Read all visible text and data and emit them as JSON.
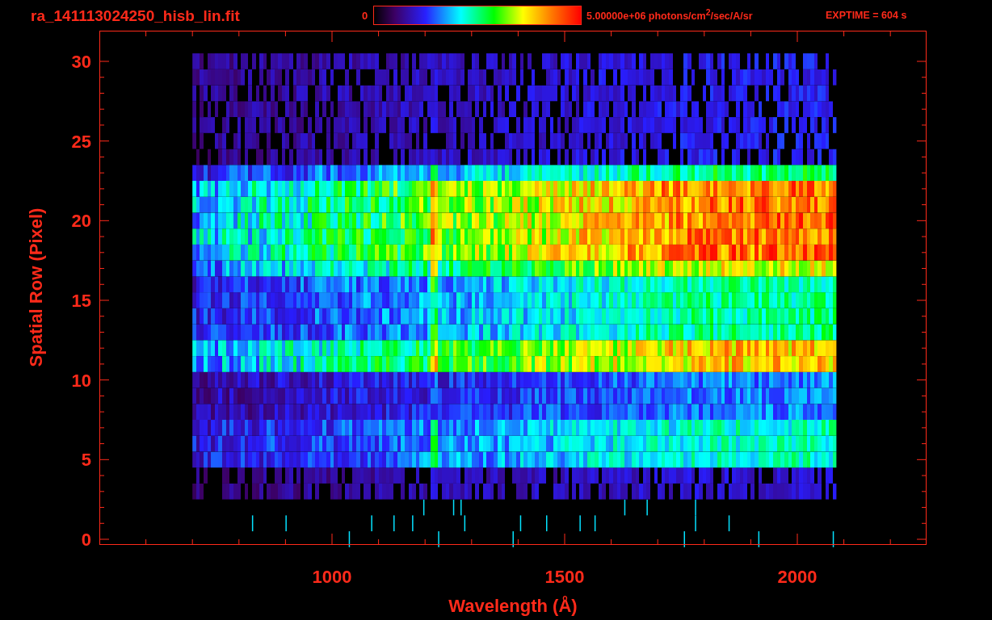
{
  "title": "ra_141113024250_hisb_lin.fit",
  "colorbar": {
    "min_label": "0",
    "max_label": "5.00000e+06 photons/cm$^{2}$/sec/A/sr"
  },
  "exposure": "EXPTIME = 604 s",
  "y_axis": {
    "label": "Spatial Row (Pixel)",
    "ticks": [
      "30",
      "25",
      "20",
      "15",
      "10",
      "5",
      "0"
    ]
  },
  "x_axis": {
    "label": "Wavelength (Å)",
    "ticks": [
      "1000",
      "1500",
      "2000"
    ]
  }
}
